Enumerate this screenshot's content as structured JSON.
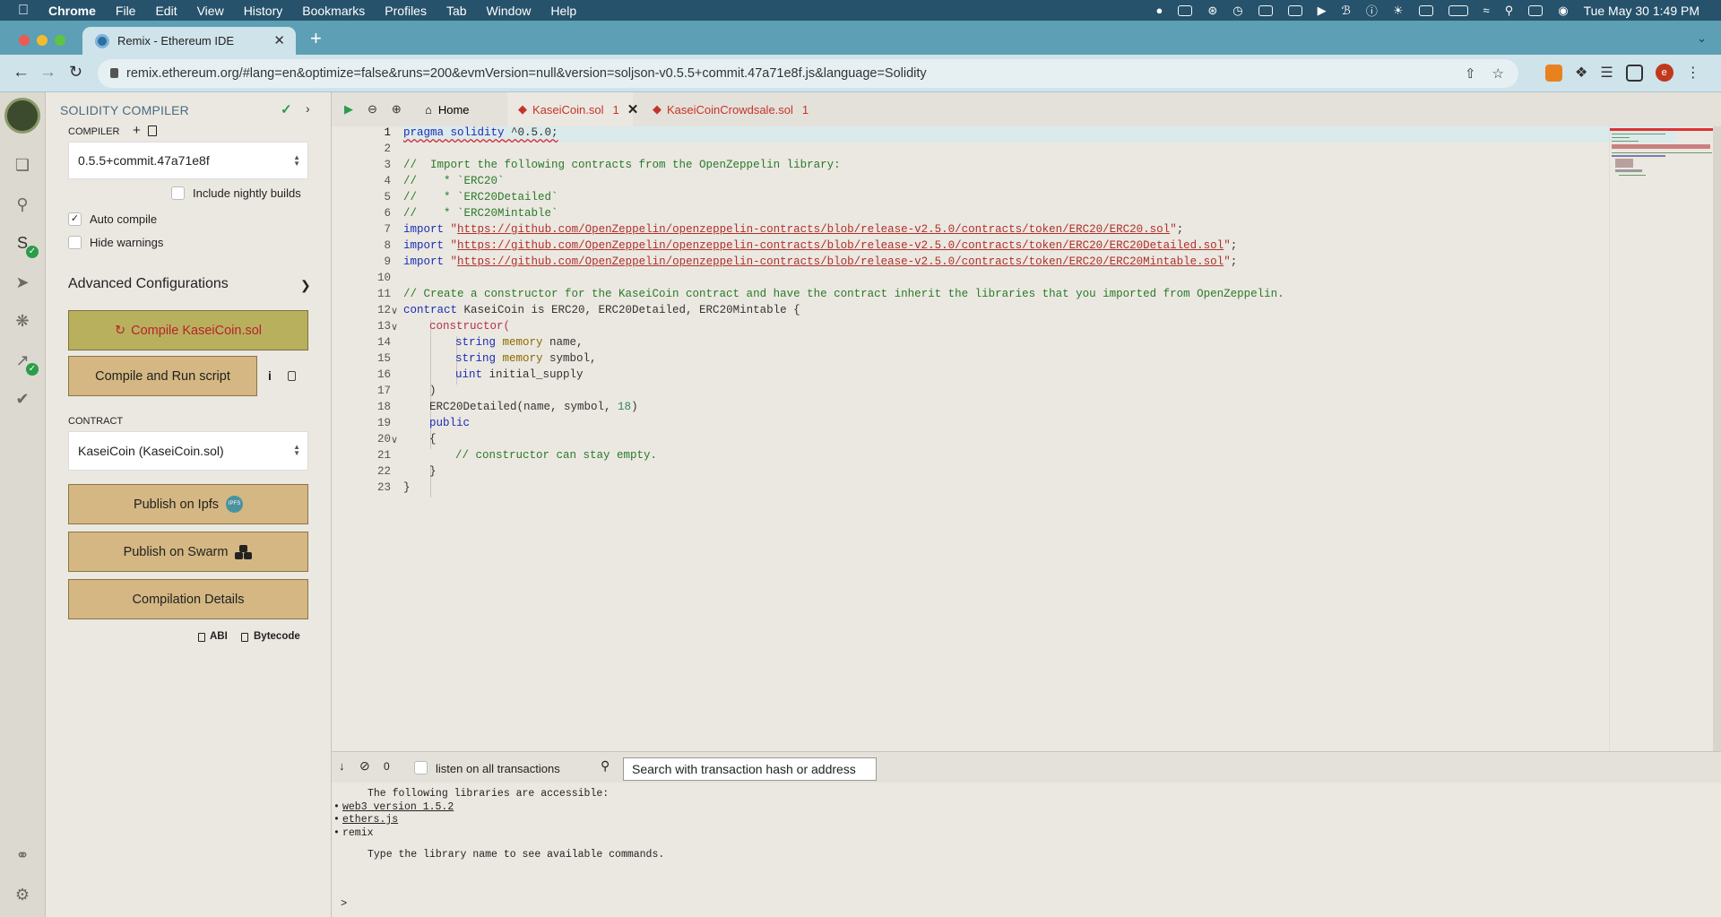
{
  "menubar": {
    "app": "Chrome",
    "items": [
      "File",
      "Edit",
      "View",
      "History",
      "Bookmarks",
      "Profiles",
      "Tab",
      "Window",
      "Help"
    ],
    "datetime": "Tue May 30  1:49 PM"
  },
  "browser": {
    "tab_title": "Remix - Ethereum IDE",
    "new_tab": "+",
    "url": "remix.ethereum.org/#lang=en&optimize=false&runs=200&evmVersion=null&version=soljson-v0.5.5+commit.47a71e8f.js&language=Solidity",
    "avatar_letter": "e"
  },
  "panel": {
    "title": "SOLIDITY COMPILER",
    "compiler_label": "COMPILER",
    "compiler_version": "0.5.5+commit.47a71e8f",
    "include_nightly": "Include nightly builds",
    "auto_compile": "Auto compile",
    "auto_compile_checked": true,
    "hide_warnings": "Hide warnings",
    "advanced": "Advanced Configurations",
    "compile_button": "Compile KaseiCoin.sol",
    "compile_run_button": "Compile and Run script",
    "contract_label": "CONTRACT",
    "contract_value": "KaseiCoin (KaseiCoin.sol)",
    "publish_ipfs": "Publish on Ipfs",
    "ipfs_badge": "IPFS",
    "publish_swarm": "Publish on Swarm",
    "compilation_details": "Compilation Details",
    "abi": "ABI",
    "bytecode": "Bytecode"
  },
  "editor": {
    "home_tab": "Home",
    "tabs": [
      {
        "name": "KaseiCoin.sol",
        "count": "1"
      },
      {
        "name": "KaseiCoinCrowdsale.sol",
        "count": "1"
      }
    ],
    "line_numbers": [
      "1",
      "2",
      "3",
      "4",
      "5",
      "6",
      "7",
      "8",
      "9",
      "10",
      "11",
      "12",
      "13",
      "14",
      "15",
      "16",
      "17",
      "18",
      "19",
      "20",
      "21",
      "22",
      "23"
    ],
    "code": {
      "l1_a": "pragma solidity",
      "l1_b": " ^0.5.0;",
      "l3": "//  Import the following contracts from the OpenZeppelin library:",
      "l4": "//    * `ERC20`",
      "l5": "//    * `ERC20Detailed`",
      "l6": "//    * `ERC20Mintable`",
      "import_kw": "import",
      "l7_url": "https://github.com/OpenZeppelin/openzeppelin-contracts/blob/release-v2.5.0/contracts/token/ERC20/ERC20.sol",
      "l8_url": "https://github.com/OpenZeppelin/openzeppelin-contracts/blob/release-v2.5.0/contracts/token/ERC20/ERC20Detailed.sol",
      "l9_url": "https://github.com/OpenZeppelin/openzeppelin-contracts/blob/release-v2.5.0/contracts/token/ERC20/ERC20Mintable.sol",
      "l11": "// Create a constructor for the KaseiCoin contract and have the contract inherit the libraries that you imported from OpenZeppelin.",
      "l12_kw": "contract",
      "l12_rest": " KaseiCoin is ERC20, ERC20Detailed, ERC20Mintable {",
      "l13": "constructor(",
      "string_kw": "string",
      "memory_kw": "memory",
      "l14_name": " name,",
      "l15_name": " symbol,",
      "l16_kw": "uint",
      "l16_name": " initial_supply",
      "l17": ")",
      "l18_a": "ERC20Detailed(name, symbol, ",
      "l18_num": "18",
      "l18_b": ")",
      "l19": "public",
      "l20": "{",
      "l21": "// constructor can stay empty.",
      "l22": "}",
      "l23": "}"
    }
  },
  "terminal": {
    "count": "0",
    "listen_label": "listen on all transactions",
    "search_placeholder": "Search with transaction hash or address",
    "intro": "The following libraries are accessible:",
    "libs": [
      "web3 version 1.5.2",
      "ethers.js",
      "remix"
    ],
    "hint": "Type the library name to see available commands.",
    "prompt": ">"
  }
}
